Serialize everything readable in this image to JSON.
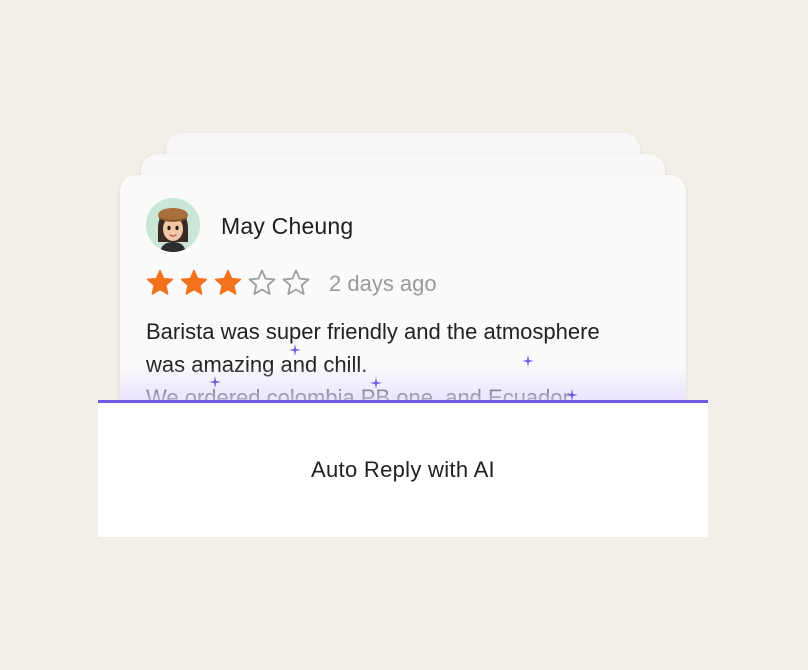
{
  "review": {
    "reviewer_name": "May Cheung",
    "rating": 3,
    "max_rating": 5,
    "time_ago": "2 days ago",
    "text_lines": [
      "Barista was super friendly and the atmosphere",
      "was amazing and chill.",
      "We ordered colombia PB one, and Ecuador"
    ]
  },
  "action": {
    "label": "Auto Reply with AI"
  },
  "colors": {
    "background": "#f2efe8",
    "star_filled": "#f2711c",
    "star_empty": "#9e9e9e",
    "accent": "#6e5be6",
    "avatar_bg": "#c9e6d6"
  }
}
